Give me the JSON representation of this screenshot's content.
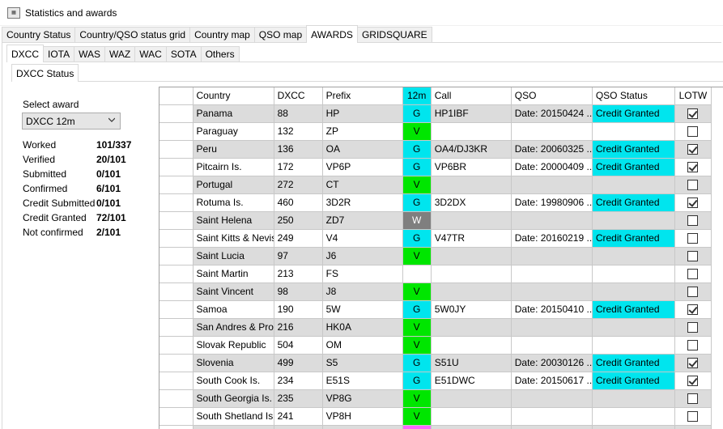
{
  "window": {
    "title": "Statistics and awards",
    "icon": "app-icon"
  },
  "tabs_main": [
    {
      "label": "Country Status",
      "active": false
    },
    {
      "label": "Country/QSO status grid",
      "active": false
    },
    {
      "label": "Country map",
      "active": false
    },
    {
      "label": "QSO map",
      "active": false
    },
    {
      "label": "AWARDS",
      "active": true
    },
    {
      "label": "GRIDSQUARE",
      "active": false
    }
  ],
  "tabs_award": [
    {
      "label": "DXCC",
      "active": true
    },
    {
      "label": "IOTA",
      "active": false
    },
    {
      "label": "WAS",
      "active": false
    },
    {
      "label": "WAZ",
      "active": false
    },
    {
      "label": "WAC",
      "active": false
    },
    {
      "label": "SOTA",
      "active": false
    },
    {
      "label": "Others",
      "active": false
    }
  ],
  "tabs_sub": [
    {
      "label": "DXCC Status",
      "active": true
    }
  ],
  "award_select": {
    "label": "Select award",
    "value": "DXCC 12m"
  },
  "stats": [
    {
      "label": "Worked",
      "value": "101/337"
    },
    {
      "label": "Verified",
      "value": "20/101"
    },
    {
      "label": "Submitted",
      "value": "0/101"
    },
    {
      "label": "Confirmed",
      "value": "6/101"
    },
    {
      "label": "Credit Submitted",
      "value": "0/101"
    },
    {
      "label": "Credit Granted",
      "value": "72/101"
    },
    {
      "label": "Not confirmed",
      "value": "2/101"
    }
  ],
  "grid": {
    "columns": [
      "Country",
      "DXCC",
      "Prefix",
      "12m",
      "Call",
      "QSO",
      "QSO Status",
      "LOTW"
    ],
    "colors": {
      "G": "#00e5ee",
      "V": "#00e600",
      "W": "#7f7f7f",
      "credit": "#00e5ee",
      "last": "#ff66ff"
    },
    "rows": [
      {
        "country": "Panama",
        "dxcc": "88",
        "prefix": "HP",
        "band": "G",
        "call": "HP1IBF",
        "qso": "Date: 20150424 ...",
        "status": "Credit Granted",
        "lotw": true
      },
      {
        "country": "Paraguay",
        "dxcc": "132",
        "prefix": "ZP",
        "band": "V",
        "call": "",
        "qso": "",
        "status": "",
        "lotw": false
      },
      {
        "country": "Peru",
        "dxcc": "136",
        "prefix": "OA",
        "band": "G",
        "call": "OA4/DJ3KR",
        "qso": "Date: 20060325 ...",
        "status": "Credit Granted",
        "lotw": true
      },
      {
        "country": "Pitcairn Is.",
        "dxcc": "172",
        "prefix": "VP6P",
        "band": "G",
        "call": "VP6BR",
        "qso": "Date: 20000409 ...",
        "status": "Credit Granted",
        "lotw": true
      },
      {
        "country": "Portugal",
        "dxcc": "272",
        "prefix": "CT",
        "band": "V",
        "call": "",
        "qso": "",
        "status": "",
        "lotw": false
      },
      {
        "country": "Rotuma Is.",
        "dxcc": "460",
        "prefix": "3D2R",
        "band": "G",
        "call": "3D2DX",
        "qso": "Date: 19980906 ...",
        "status": "Credit Granted",
        "lotw": true
      },
      {
        "country": "Saint Helena",
        "dxcc": "250",
        "prefix": "ZD7",
        "band": "W",
        "call": "",
        "qso": "",
        "status": "",
        "lotw": false
      },
      {
        "country": "Saint Kitts & Nevis",
        "dxcc": "249",
        "prefix": "V4",
        "band": "G",
        "call": "V47TR",
        "qso": "Date: 20160219 ...",
        "status": "Credit Granted",
        "lotw": false
      },
      {
        "country": "Saint Lucia",
        "dxcc": "97",
        "prefix": "J6",
        "band": "V",
        "call": "",
        "qso": "",
        "status": "",
        "lotw": false
      },
      {
        "country": "Saint Martin",
        "dxcc": "213",
        "prefix": "FS",
        "band": "",
        "call": "",
        "qso": "",
        "status": "",
        "lotw": false
      },
      {
        "country": "Saint Vincent",
        "dxcc": "98",
        "prefix": "J8",
        "band": "V",
        "call": "",
        "qso": "",
        "status": "",
        "lotw": false
      },
      {
        "country": "Samoa",
        "dxcc": "190",
        "prefix": "5W",
        "band": "G",
        "call": "5W0JY",
        "qso": "Date: 20150410 ...",
        "status": "Credit Granted",
        "lotw": true
      },
      {
        "country": "San Andres & Pro...",
        "dxcc": "216",
        "prefix": "HK0A",
        "band": "V",
        "call": "",
        "qso": "",
        "status": "",
        "lotw": false
      },
      {
        "country": "Slovak Republic",
        "dxcc": "504",
        "prefix": "OM",
        "band": "V",
        "call": "",
        "qso": "",
        "status": "",
        "lotw": false
      },
      {
        "country": "Slovenia",
        "dxcc": "499",
        "prefix": "S5",
        "band": "G",
        "call": "S51U",
        "qso": "Date: 20030126 ...",
        "status": "Credit Granted",
        "lotw": true
      },
      {
        "country": "South Cook Is.",
        "dxcc": "234",
        "prefix": "E51S",
        "band": "G",
        "call": "E51DWC",
        "qso": "Date: 20150617 ...",
        "status": "Credit Granted",
        "lotw": true
      },
      {
        "country": "South Georgia Is.",
        "dxcc": "235",
        "prefix": "VP8G",
        "band": "V",
        "call": "",
        "qso": "",
        "status": "",
        "lotw": false
      },
      {
        "country": "South Shetland Is.",
        "dxcc": "241",
        "prefix": "VP8H",
        "band": "V",
        "call": "",
        "qso": "",
        "status": "",
        "lotw": false
      },
      {
        "country": "",
        "dxcc": "",
        "prefix": "",
        "band": "",
        "call": "",
        "qso": "",
        "status": "",
        "lotw": false,
        "partial": true
      }
    ]
  }
}
